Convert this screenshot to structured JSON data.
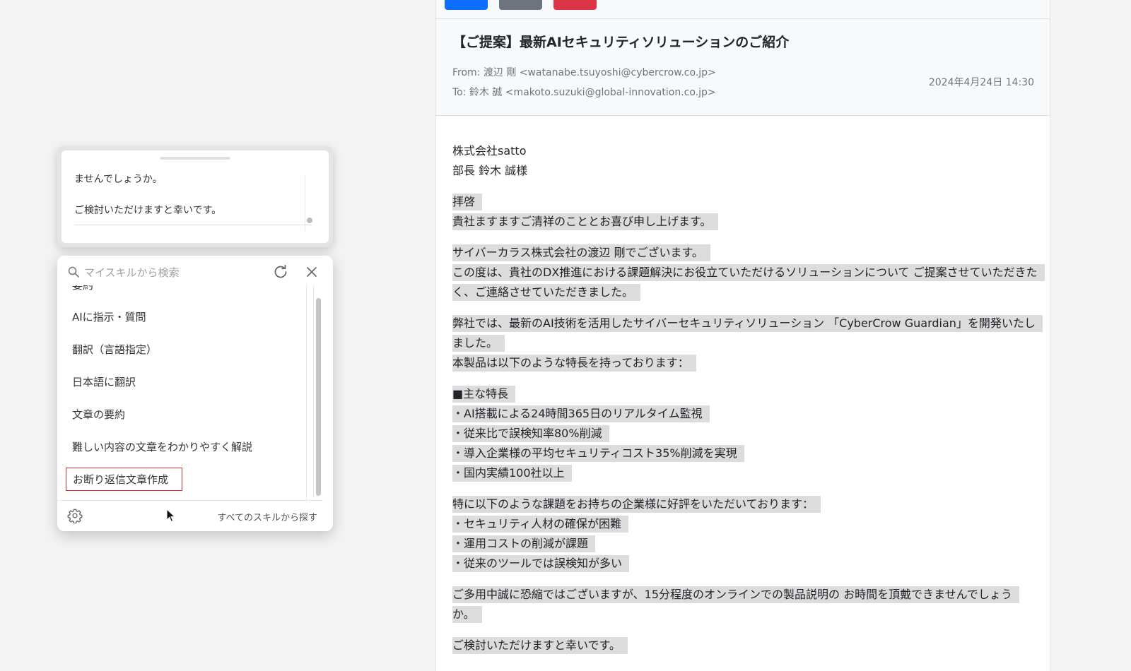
{
  "toolbar": {
    "buttons": [
      {
        "name": "send",
        "color": "#0d6efd"
      },
      {
        "name": "secondary",
        "color": "#6c757d"
      },
      {
        "name": "delete",
        "color": "#dc3545"
      }
    ]
  },
  "email": {
    "subject": "【ご提案】最新AIセキュリティソリューションのご紹介",
    "from": "From: 渡辺 剛 <watanabe.tsuyoshi@cybercrow.co.jp>",
    "to": "To: 鈴木 誠 <makoto.suzuki@global-innovation.co.jp>",
    "date": "2024年4月24日 14:30",
    "recipient_company": "株式会社satto",
    "recipient_name": "部長 鈴木 誠様",
    "paragraphs": [
      [
        "拝啓",
        "貴社ますますご清祥のこととお喜び申し上げます。"
      ],
      [
        "サイバーカラス株式会社の渡辺 剛でございます。",
        "この度は、貴社のDX推進における課題解決にお役立ていただけるソリューションについて ご提案させていただきたく、ご連絡させていただきました。"
      ],
      [
        "弊社では、最新のAI技術を活用したサイバーセキュリティソリューション 「CyberCrow Guardian」を開発いたしました。",
        "本製品は以下のような特長を持っております："
      ],
      [
        "■主な特長",
        "・AI搭載による24時間365日のリアルタイム監視",
        "・従来比で誤検知率80%削減",
        "・導入企業様の平均セキュリティコスト35%削減を実現",
        "・国内実績100社以上"
      ],
      [
        "特に以下のような課題をお持ちの企業様に好評をいただいております：",
        "・セキュリティ人材の確保が困難",
        "・運用コストの削減が課題",
        "・従来のツールでは誤検知が多い"
      ],
      [
        "ご多用中誠に恐縮ではございますが、15分程度のオンラインでの製品説明の お時間を頂戴できませんでしょうか。"
      ],
      [
        "ご検討いただけますと幸いです。"
      ]
    ]
  },
  "preview": {
    "lines": [
      "ませんでしょうか。",
      "ご検討いただけますと幸いです。"
    ]
  },
  "skills_panel": {
    "search_placeholder": "マイスキルから検索",
    "partial_item": "要約",
    "items": [
      "AIに指示・質問",
      "翻訳（言語指定）",
      "日本語に翻訳",
      "文章の要約",
      "難しい内容の文章をわかりやすく解説",
      "お断り返信文章作成"
    ],
    "selected_index": 5,
    "all_skills_link": "すべてのスキルから探す"
  },
  "icons": {
    "search": "search-icon",
    "refresh": "refresh-icon",
    "close": "close-icon",
    "settings": "gear-icon",
    "cursor": "mouse-cursor-icon"
  },
  "colors": {
    "highlight": "#dcdcdc",
    "selection_border": "#d32f2f",
    "primary": "#0d6efd",
    "danger": "#dc3545",
    "secondary": "#6c757d"
  }
}
